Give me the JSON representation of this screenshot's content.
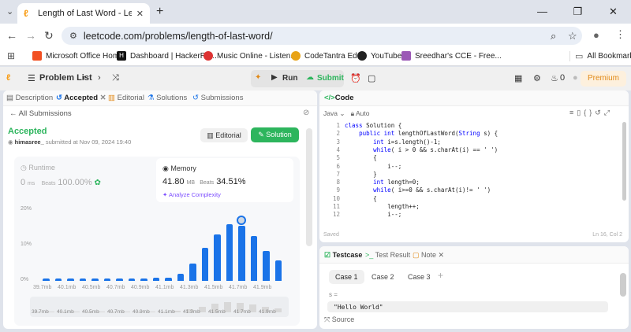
{
  "browser": {
    "tab_title": "Length of Last Word - LeetCode",
    "url": "leetcode.com/problems/length-of-last-word/",
    "bookmarks": [
      "Microsoft Office Home",
      "Dashboard | HackerRa...",
      "Music Online - Listen...",
      "CodeTantra Edu",
      "YouTube",
      "Sreedhar's CCE - Free..."
    ],
    "all_bookmarks": "All Bookmarks"
  },
  "lc_header": {
    "problem_list": "Problem List",
    "run": "Run",
    "submit": "Submit",
    "streak": "0",
    "premium": "Premium"
  },
  "left_tabs": [
    "Description",
    "Accepted",
    "Editorial",
    "Solutions",
    "Submissions"
  ],
  "submission": {
    "all_submissions": "All Submissions",
    "status": "Accepted",
    "user": "himasree_",
    "submitted_text": "submitted at Nov 09, 2024 19:40",
    "editorial_btn": "Editorial",
    "solution_btn": "Solution",
    "runtime_label": "Runtime",
    "runtime_value": "0",
    "runtime_unit": "ms",
    "runtime_beats_label": "Beats",
    "runtime_beats": "100.00%",
    "memory_label": "Memory",
    "memory_value": "41.80",
    "memory_unit": "MB",
    "memory_beats_label": "Beats",
    "memory_beats": "34.51%",
    "analyze": "Analyze Complexity"
  },
  "chart_data": {
    "type": "bar",
    "ytick_labels": [
      "20%",
      "10%",
      "0%"
    ],
    "ylim": [
      0,
      20
    ],
    "xtick_labels": [
      "39.7mb",
      "40.1mb",
      "40.5mb",
      "40.7mb",
      "40.9mb",
      "41.1mb",
      "41.3mb",
      "41.5mb",
      "41.7mb",
      "41.9mb"
    ],
    "values": [
      0.6,
      0.6,
      0.6,
      0.6,
      0.6,
      0.6,
      0.6,
      0.6,
      0.6,
      0.8,
      1,
      2,
      4.8,
      9.3,
      13.2,
      16,
      15.5,
      12.6,
      8.5,
      5.7
    ],
    "highlight_index": 16,
    "minimap_labels": [
      "39.7mb",
      "40.1mb",
      "40.5mb",
      "40.7mb",
      "40.9mb",
      "41.1mb",
      "41.3mb",
      "41.5mb",
      "41.7mb",
      "41.9mb"
    ]
  },
  "code": {
    "title": "Code",
    "language": "Java",
    "mode": "Auto",
    "lines": [
      "class Solution {",
      "    public int lengthOfLastWord(String s) {",
      "        int i=s.length()-1;",
      "        while( i > 0 && s.charAt(i) == ' ')",
      "        {",
      "            i--;",
      "        }",
      "        int length=0;",
      "        while( i>=0 && s.charAt(i)!= ' ')",
      "        {",
      "            length++;",
      "            i--;"
    ],
    "line_numbers": [
      "1",
      "2",
      "3",
      "4",
      "5",
      "6",
      "7",
      "8",
      "9",
      "10",
      "11",
      "12"
    ],
    "saved": "Saved",
    "cursor": "Ln 16, Col 2"
  },
  "test": {
    "tabs": [
      "Testcase",
      "Test Result",
      "Note"
    ],
    "cases": [
      "Case 1",
      "Case 2",
      "Case 3"
    ],
    "var_label": "s =",
    "var_value": "\"Hello World\"",
    "source": "Source"
  },
  "colors": {
    "accent_green": "#2db55d",
    "bar_blue": "#1a73e8",
    "premium": "#e18a18"
  }
}
